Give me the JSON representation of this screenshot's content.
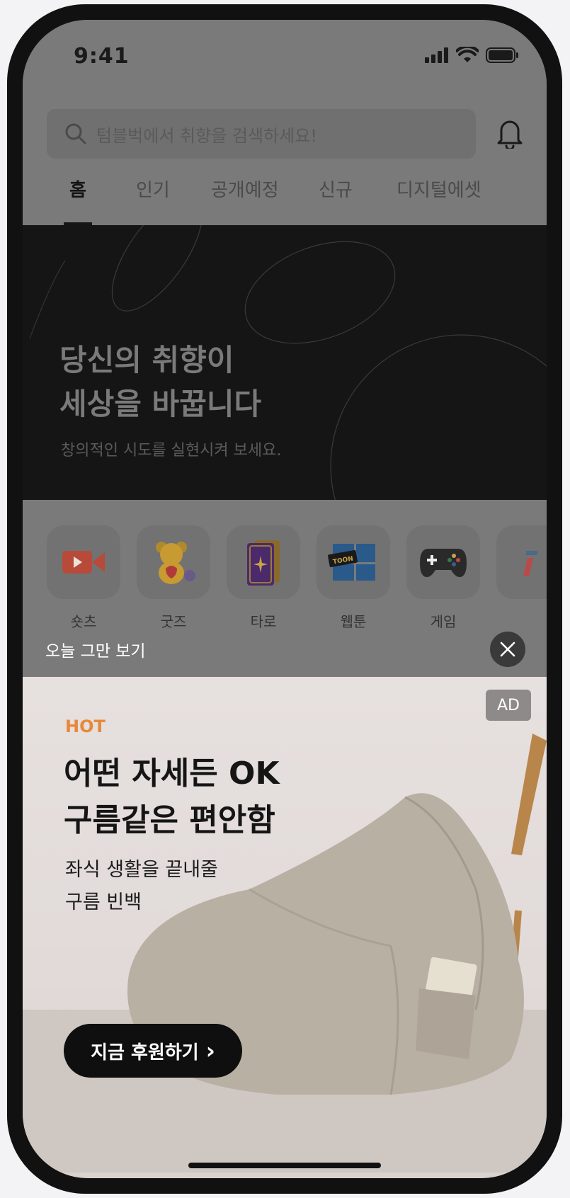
{
  "status_bar": {
    "time": "9:41"
  },
  "search": {
    "placeholder": "텀블벅에서 취향을 검색하세요!"
  },
  "tabs": [
    {
      "label": "홈",
      "active": true
    },
    {
      "label": "인기",
      "active": false
    },
    {
      "label": "공개예정",
      "active": false
    },
    {
      "label": "신규",
      "active": false
    },
    {
      "label": "디지털에셋",
      "active": false
    }
  ],
  "hero": {
    "title_line1": "당신의 취향이",
    "title_line2": "세상을 바꿉니다",
    "subtitle": "창의적인 시도를 실현시켜 보세요."
  },
  "categories": [
    {
      "label": "숏츠",
      "icon": "video-camera-icon"
    },
    {
      "label": "굿즈",
      "icon": "teddy-bear-icon"
    },
    {
      "label": "타로",
      "icon": "tarot-card-icon"
    },
    {
      "label": "웹툰",
      "icon": "webtoon-icon"
    },
    {
      "label": "게임",
      "icon": "gamepad-icon"
    }
  ],
  "dismiss": {
    "label": "오늘 그만 보기"
  },
  "ad": {
    "badge": "AD",
    "tag": "HOT",
    "title_line1": "어떤 자세든 OK",
    "title_line2": "구름같은 편안함",
    "desc_line1": "좌식 생활을 끝내줄",
    "desc_line2": "구름 빈백",
    "cta_label": "지금 후원하기",
    "cta_chevron": "›"
  },
  "webtoon_icon_text": "TOON",
  "colors": {
    "accent_hot": "#e8883a",
    "dim_overlay": "#7a7a7a",
    "hero_bg": "#151515"
  }
}
